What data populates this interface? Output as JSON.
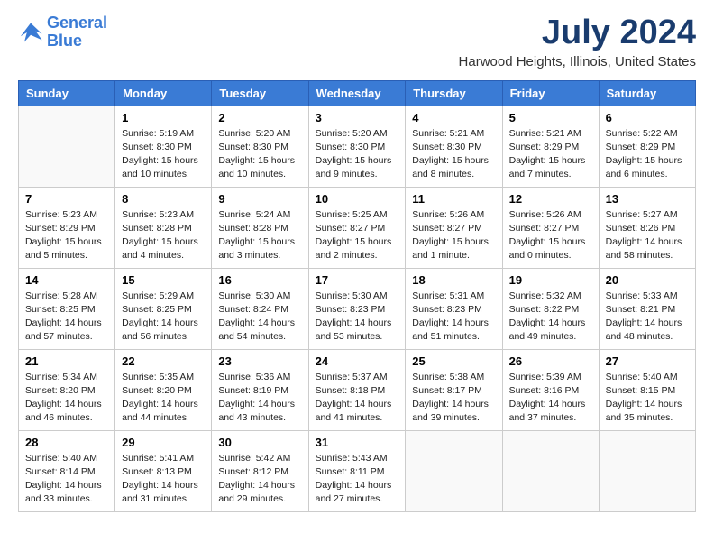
{
  "logo": {
    "line1": "General",
    "line2": "Blue"
  },
  "title": {
    "month_year": "July 2024",
    "location": "Harwood Heights, Illinois, United States"
  },
  "headers": [
    "Sunday",
    "Monday",
    "Tuesday",
    "Wednesday",
    "Thursday",
    "Friday",
    "Saturday"
  ],
  "weeks": [
    [
      {
        "day": "",
        "sunrise": "",
        "sunset": "",
        "daylight": ""
      },
      {
        "day": "1",
        "sunrise": "Sunrise: 5:19 AM",
        "sunset": "Sunset: 8:30 PM",
        "daylight": "Daylight: 15 hours and 10 minutes."
      },
      {
        "day": "2",
        "sunrise": "Sunrise: 5:20 AM",
        "sunset": "Sunset: 8:30 PM",
        "daylight": "Daylight: 15 hours and 10 minutes."
      },
      {
        "day": "3",
        "sunrise": "Sunrise: 5:20 AM",
        "sunset": "Sunset: 8:30 PM",
        "daylight": "Daylight: 15 hours and 9 minutes."
      },
      {
        "day": "4",
        "sunrise": "Sunrise: 5:21 AM",
        "sunset": "Sunset: 8:30 PM",
        "daylight": "Daylight: 15 hours and 8 minutes."
      },
      {
        "day": "5",
        "sunrise": "Sunrise: 5:21 AM",
        "sunset": "Sunset: 8:29 PM",
        "daylight": "Daylight: 15 hours and 7 minutes."
      },
      {
        "day": "6",
        "sunrise": "Sunrise: 5:22 AM",
        "sunset": "Sunset: 8:29 PM",
        "daylight": "Daylight: 15 hours and 6 minutes."
      }
    ],
    [
      {
        "day": "7",
        "sunrise": "Sunrise: 5:23 AM",
        "sunset": "Sunset: 8:29 PM",
        "daylight": "Daylight: 15 hours and 5 minutes."
      },
      {
        "day": "8",
        "sunrise": "Sunrise: 5:23 AM",
        "sunset": "Sunset: 8:28 PM",
        "daylight": "Daylight: 15 hours and 4 minutes."
      },
      {
        "day": "9",
        "sunrise": "Sunrise: 5:24 AM",
        "sunset": "Sunset: 8:28 PM",
        "daylight": "Daylight: 15 hours and 3 minutes."
      },
      {
        "day": "10",
        "sunrise": "Sunrise: 5:25 AM",
        "sunset": "Sunset: 8:27 PM",
        "daylight": "Daylight: 15 hours and 2 minutes."
      },
      {
        "day": "11",
        "sunrise": "Sunrise: 5:26 AM",
        "sunset": "Sunset: 8:27 PM",
        "daylight": "Daylight: 15 hours and 1 minute."
      },
      {
        "day": "12",
        "sunrise": "Sunrise: 5:26 AM",
        "sunset": "Sunset: 8:27 PM",
        "daylight": "Daylight: 15 hours and 0 minutes."
      },
      {
        "day": "13",
        "sunrise": "Sunrise: 5:27 AM",
        "sunset": "Sunset: 8:26 PM",
        "daylight": "Daylight: 14 hours and 58 minutes."
      }
    ],
    [
      {
        "day": "14",
        "sunrise": "Sunrise: 5:28 AM",
        "sunset": "Sunset: 8:25 PM",
        "daylight": "Daylight: 14 hours and 57 minutes."
      },
      {
        "day": "15",
        "sunrise": "Sunrise: 5:29 AM",
        "sunset": "Sunset: 8:25 PM",
        "daylight": "Daylight: 14 hours and 56 minutes."
      },
      {
        "day": "16",
        "sunrise": "Sunrise: 5:30 AM",
        "sunset": "Sunset: 8:24 PM",
        "daylight": "Daylight: 14 hours and 54 minutes."
      },
      {
        "day": "17",
        "sunrise": "Sunrise: 5:30 AM",
        "sunset": "Sunset: 8:23 PM",
        "daylight": "Daylight: 14 hours and 53 minutes."
      },
      {
        "day": "18",
        "sunrise": "Sunrise: 5:31 AM",
        "sunset": "Sunset: 8:23 PM",
        "daylight": "Daylight: 14 hours and 51 minutes."
      },
      {
        "day": "19",
        "sunrise": "Sunrise: 5:32 AM",
        "sunset": "Sunset: 8:22 PM",
        "daylight": "Daylight: 14 hours and 49 minutes."
      },
      {
        "day": "20",
        "sunrise": "Sunrise: 5:33 AM",
        "sunset": "Sunset: 8:21 PM",
        "daylight": "Daylight: 14 hours and 48 minutes."
      }
    ],
    [
      {
        "day": "21",
        "sunrise": "Sunrise: 5:34 AM",
        "sunset": "Sunset: 8:20 PM",
        "daylight": "Daylight: 14 hours and 46 minutes."
      },
      {
        "day": "22",
        "sunrise": "Sunrise: 5:35 AM",
        "sunset": "Sunset: 8:20 PM",
        "daylight": "Daylight: 14 hours and 44 minutes."
      },
      {
        "day": "23",
        "sunrise": "Sunrise: 5:36 AM",
        "sunset": "Sunset: 8:19 PM",
        "daylight": "Daylight: 14 hours and 43 minutes."
      },
      {
        "day": "24",
        "sunrise": "Sunrise: 5:37 AM",
        "sunset": "Sunset: 8:18 PM",
        "daylight": "Daylight: 14 hours and 41 minutes."
      },
      {
        "day": "25",
        "sunrise": "Sunrise: 5:38 AM",
        "sunset": "Sunset: 8:17 PM",
        "daylight": "Daylight: 14 hours and 39 minutes."
      },
      {
        "day": "26",
        "sunrise": "Sunrise: 5:39 AM",
        "sunset": "Sunset: 8:16 PM",
        "daylight": "Daylight: 14 hours and 37 minutes."
      },
      {
        "day": "27",
        "sunrise": "Sunrise: 5:40 AM",
        "sunset": "Sunset: 8:15 PM",
        "daylight": "Daylight: 14 hours and 35 minutes."
      }
    ],
    [
      {
        "day": "28",
        "sunrise": "Sunrise: 5:40 AM",
        "sunset": "Sunset: 8:14 PM",
        "daylight": "Daylight: 14 hours and 33 minutes."
      },
      {
        "day": "29",
        "sunrise": "Sunrise: 5:41 AM",
        "sunset": "Sunset: 8:13 PM",
        "daylight": "Daylight: 14 hours and 31 minutes."
      },
      {
        "day": "30",
        "sunrise": "Sunrise: 5:42 AM",
        "sunset": "Sunset: 8:12 PM",
        "daylight": "Daylight: 14 hours and 29 minutes."
      },
      {
        "day": "31",
        "sunrise": "Sunrise: 5:43 AM",
        "sunset": "Sunset: 8:11 PM",
        "daylight": "Daylight: 14 hours and 27 minutes."
      },
      {
        "day": "",
        "sunrise": "",
        "sunset": "",
        "daylight": ""
      },
      {
        "day": "",
        "sunrise": "",
        "sunset": "",
        "daylight": ""
      },
      {
        "day": "",
        "sunrise": "",
        "sunset": "",
        "daylight": ""
      }
    ]
  ]
}
